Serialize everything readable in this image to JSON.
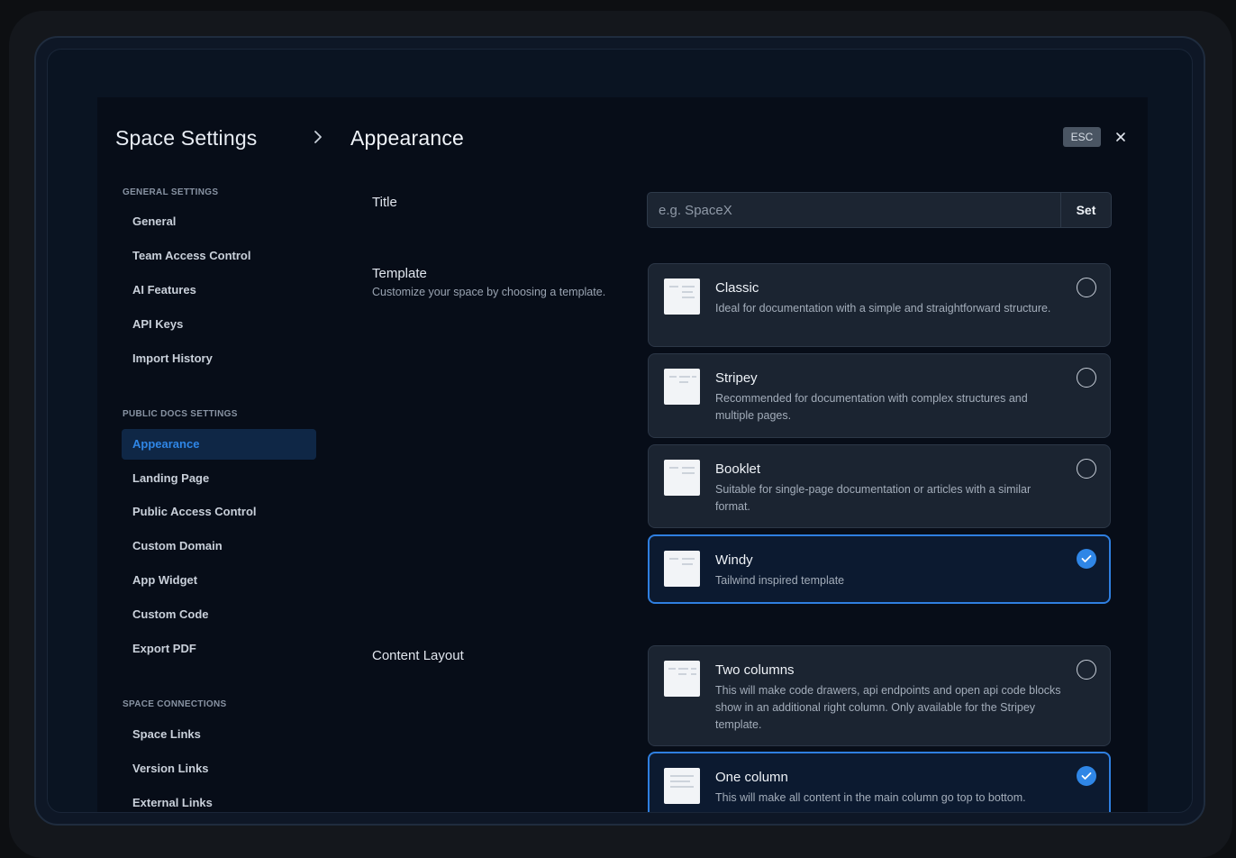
{
  "header": {
    "section_title": "Space Settings",
    "page_title": "Appearance",
    "esc_label": "ESC"
  },
  "sidebar": {
    "sections": [
      {
        "heading": "GENERAL SETTINGS",
        "items": [
          "General",
          "Team Access Control",
          "AI Features",
          "API Keys",
          "Import History"
        ]
      },
      {
        "heading": "PUBLIC DOCS SETTINGS",
        "items": [
          "Appearance",
          "Landing Page",
          "Public Access Control",
          "Custom Domain",
          "App Widget",
          "Custom Code",
          "Export PDF"
        ]
      },
      {
        "heading": "SPACE CONNECTIONS",
        "items": [
          "Space Links",
          "Version Links",
          "External Links"
        ]
      }
    ],
    "active_item": "Appearance"
  },
  "title_field": {
    "label": "Title",
    "placeholder": "e.g. SpaceX",
    "value": "",
    "button_label": "Set"
  },
  "template_field": {
    "label": "Template",
    "description": "Customize your space by choosing a template.",
    "options": [
      {
        "title": "Classic",
        "description": "Ideal for documentation with a simple and straightforward structure.",
        "selected": false
      },
      {
        "title": "Stripey",
        "description": "Recommended for documentation with complex structures and multiple pages.",
        "selected": false
      },
      {
        "title": "Booklet",
        "description": "Suitable for single-page documentation or articles with a similar format.",
        "selected": false
      },
      {
        "title": "Windy",
        "description": "Tailwind inspired template",
        "selected": true
      }
    ]
  },
  "content_layout_field": {
    "label": "Content Layout",
    "options": [
      {
        "title": "Two columns",
        "description": "This will make code drawers, api endpoints and open api code blocks show in an additional right column. Only available for the Stripey template.",
        "selected": false
      },
      {
        "title": "One column",
        "description": "This will make all content in the main column go top to bottom.",
        "selected": true
      }
    ]
  },
  "colors": {
    "accent": "#2f86e6",
    "modal_background": "#070d18",
    "card_background": "#1b2431"
  },
  "icons": {
    "breadcrumb_separator": "chevron-right-icon",
    "close": "close-icon",
    "selected_indicator": "check-icon",
    "template_preview": "document-thumbnail-icon"
  }
}
